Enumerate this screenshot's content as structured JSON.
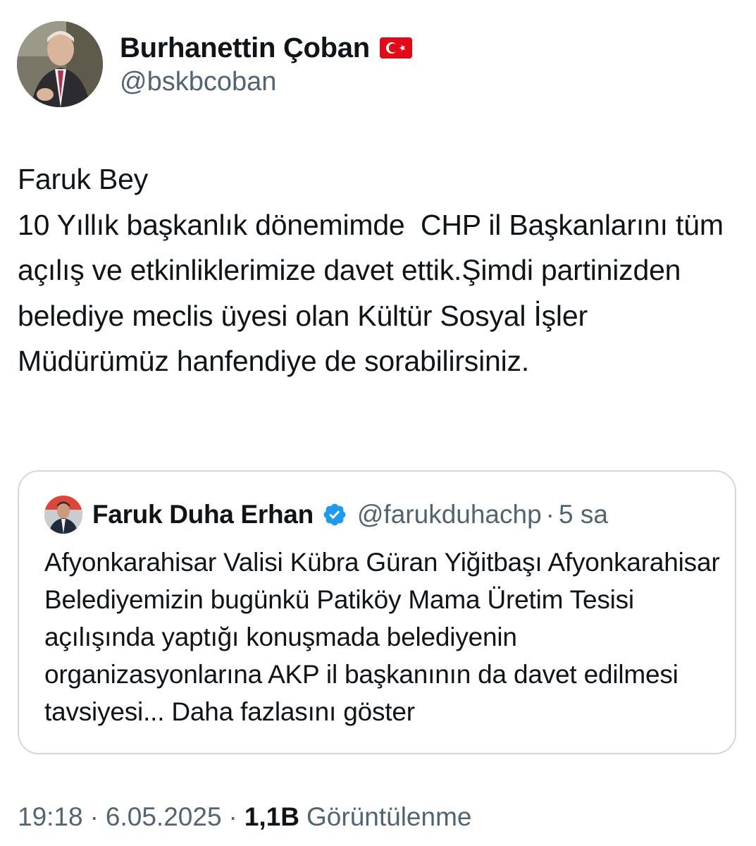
{
  "author": {
    "display_name": "Burhanettin Çoban",
    "handle": "@bskbcoban",
    "flag_icon": "turkey-flag-icon"
  },
  "tweet": {
    "text": "Faruk Bey\n10 Yıllık başkanlık dönemimde  CHP il Başkanlarını tüm açılış ve etkinliklerimize davet ettik.Şimdi partinizden belediye meclis üyesi olan Kültür Sosyal İşler Müdürümüz hanfendiye de sorabilirsiniz."
  },
  "quote": {
    "display_name": "Faruk Duha Erhan",
    "verified_icon": "verified-badge-icon",
    "handle": "@farukduhachp",
    "separator": "·",
    "time": "5 sa",
    "text": "Afyonkarahisar Valisi Kübra Güran Yiğitbaşı Afyonkarahisar Belediyemizin bugünkü Patiköy Mama Üretim Tesisi açılışında yaptığı konuşmada belediyenin organizasyonlarına AKP il başkanının da davet edilmesi tavsiyesi... ",
    "show_more": "Daha fazlasını göster"
  },
  "meta": {
    "time": "19:18",
    "separator": "·",
    "date": "6.05.2025",
    "views_count": "1,1B",
    "views_label": "Görüntülenme"
  },
  "colors": {
    "primary_text": "#0f1419",
    "secondary_text": "#536471",
    "border": "#cfd9de",
    "verified_blue": "#1d9bf0",
    "flag_red": "#e30a17"
  }
}
